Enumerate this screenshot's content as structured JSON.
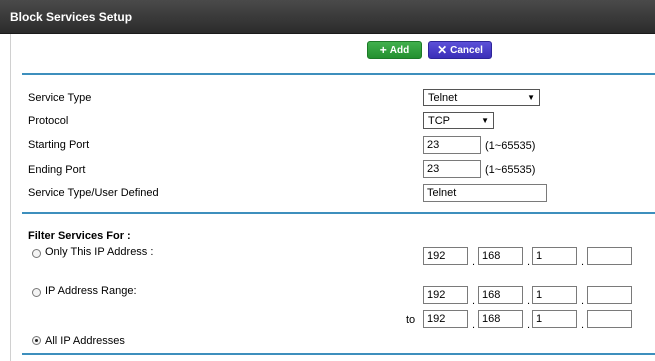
{
  "header": {
    "title": "Block Services Setup"
  },
  "toolbar": {
    "add_label": "Add",
    "cancel_label": "Cancel"
  },
  "form": {
    "service_type": {
      "label": "Service Type",
      "value": "Telnet"
    },
    "protocol": {
      "label": "Protocol",
      "value": "TCP"
    },
    "starting_port": {
      "label": "Starting Port",
      "value": "23",
      "hint": "(1~65535)"
    },
    "ending_port": {
      "label": "Ending Port",
      "value": "23",
      "hint": "(1~65535)"
    },
    "user_defined": {
      "label": "Service Type/User Defined",
      "value": "Telnet"
    }
  },
  "filter": {
    "heading": "Filter Services For :",
    "only_ip": {
      "label": "Only This IP Address :",
      "octets": [
        "192",
        "168",
        "1",
        ""
      ]
    },
    "range": {
      "label": "IP Address Range:",
      "from": [
        "192",
        "168",
        "1",
        ""
      ],
      "to_label": "to",
      "to": [
        "192",
        "168",
        "1",
        ""
      ]
    },
    "all": {
      "label": "All IP Addresses",
      "selected": true
    }
  }
}
